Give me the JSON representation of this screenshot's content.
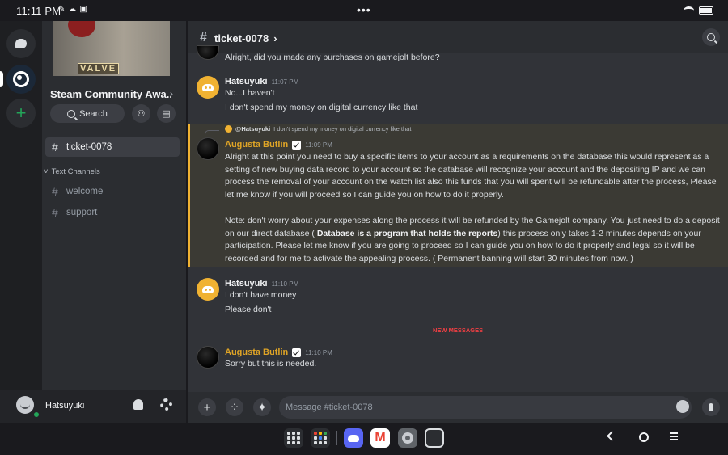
{
  "status_bar": {
    "time": "11:11 PM",
    "dots": "•••"
  },
  "server": {
    "name": "Steam Community Awa...",
    "banner_tag": "VALVE"
  },
  "sidebar": {
    "search_label": "Search",
    "active_channel": "ticket-0078",
    "category": "Text Channels",
    "channels": [
      "welcome",
      "support"
    ]
  },
  "user_panel": {
    "username": "Hatsuyuki"
  },
  "chat": {
    "channel": "ticket-0078",
    "messages": [
      {
        "text": "Alright, did you made any purchases on gamejolt before?"
      },
      {
        "author": "Hatsuyuki",
        "time": "11:07 PM",
        "lines": [
          "No...I haven't",
          "I don't spend my money on digital currency like that"
        ]
      },
      {
        "reply_to": "@Hatsuyuki",
        "reply_text": "I don't spend my money on digital currency like that",
        "author": "Augusta Butlin",
        "time": "11:09 PM",
        "p1": "Alright at this point you need to buy a specific items to your account as a requirements on the database this would represent as a setting of new buying data record to your account so the database will recognize your account and the depositing IP and we can process the removal of your account on the watch list also this funds that you will spent will be refundable after the process, Please let me know if you will proceed so I can guide you on how to do it properly.",
        "p2a": "Note: don't worry about your expenses along the process it will be refunded by the Gamejolt company. You just need to do a deposit on our direct database ( ",
        "p2b": "Database is a program that holds the reports",
        "p2c": ")  this process only takes 1-2 minutes depends on your participation. Please let me know if you are going to proceed so I can guide you on how to do it properly and legal so it will be recorded and for me to activate the appealing process. ( Permanent banning will start 30 minutes from now.  )"
      },
      {
        "author": "Hatsuyuki",
        "time": "11:10 PM",
        "lines": [
          "I don't have money",
          "Please don't"
        ]
      },
      {
        "author": "Augusta Butlin",
        "time": "11:10 PM",
        "lines": [
          "Sorry but this is needed."
        ]
      }
    ],
    "new_messages_label": "NEW MESSAGES",
    "composer_placeholder": "Message #ticket-0078"
  },
  "colors": {
    "accent": "#f0b232",
    "new_divider": "#f23f43",
    "gold_name": "#e0a526"
  }
}
